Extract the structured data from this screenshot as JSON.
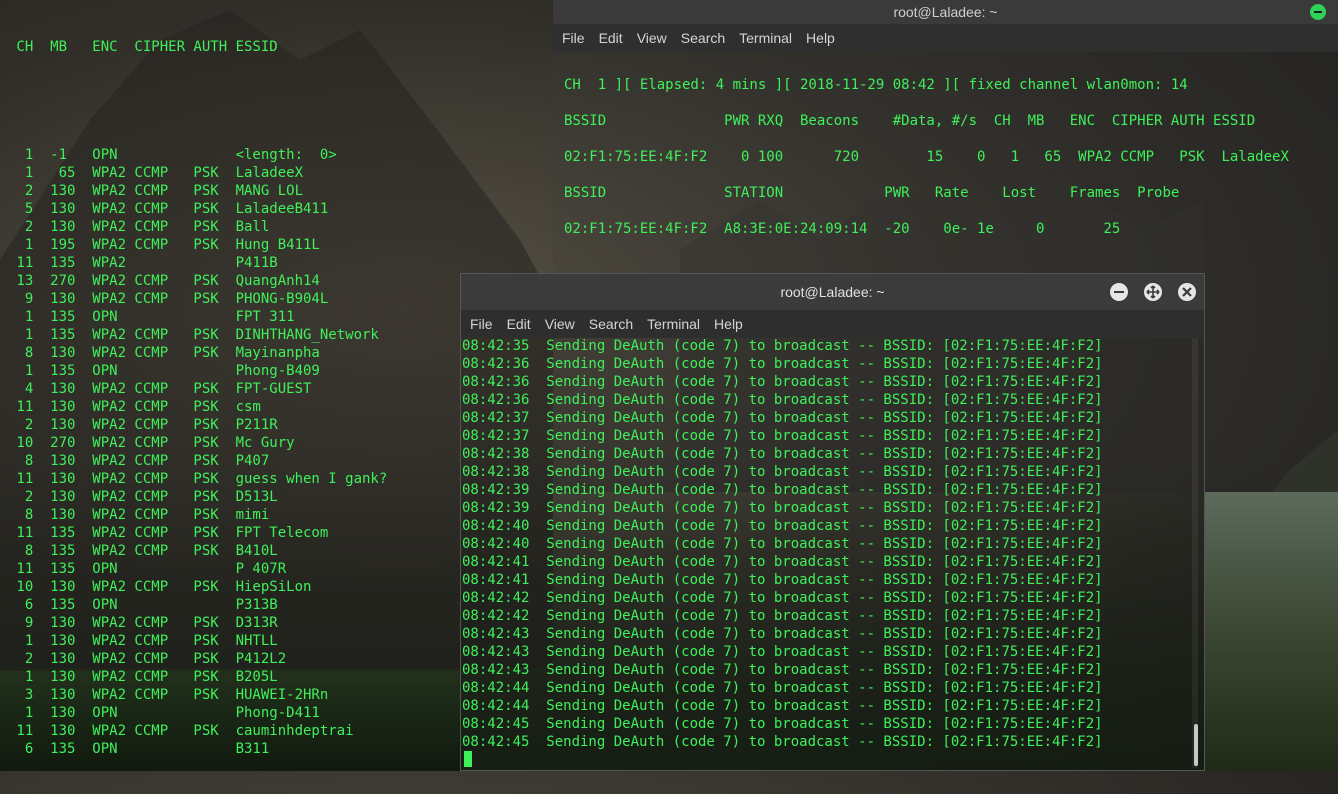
{
  "left_terminal": {
    "header": " CH  MB   ENC  CIPHER AUTH ESSID",
    "rows": [
      "  1  -1   OPN              <length:  0>",
      "  1   65  WPA2 CCMP   PSK  LaladeeX",
      "  2  130  WPA2 CCMP   PSK  MANG LOL",
      "  5  130  WPA2 CCMP   PSK  LaladeeB411",
      "  2  130  WPA2 CCMP   PSK  Ball",
      "  1  195  WPA2 CCMP   PSK  Hung B411L",
      " 11  135  WPA2             P411B",
      " 13  270  WPA2 CCMP   PSK  QuangAnh14",
      "  9  130  WPA2 CCMP   PSK  PHONG-B904L",
      "  1  135  OPN              FPT 311",
      "  1  135  WPA2 CCMP   PSK  DINHTHANG_Network",
      "  8  130  WPA2 CCMP   PSK  Mayinanpha",
      "  1  135  OPN              Phong-B409",
      "  4  130  WPA2 CCMP   PSK  FPT-GUEST",
      " 11  130  WPA2 CCMP   PSK  csm",
      "  2  130  WPA2 CCMP   PSK  P211R",
      " 10  270  WPA2 CCMP   PSK  Mc Gury",
      "  8  130  WPA2 CCMP   PSK  P407",
      " 11  130  WPA2 CCMP   PSK  guess when I gank?",
      "  2  130  WPA2 CCMP   PSK  D513L",
      "  8  130  WPA2 CCMP   PSK  mimi",
      " 11  135  WPA2 CCMP   PSK  FPT Telecom",
      "  8  135  WPA2 CCMP   PSK  B410L",
      " 11  135  OPN              P 407R",
      " 10  130  WPA2 CCMP   PSK  HiepSiLon",
      "  6  135  OPN              P313B",
      "  9  130  WPA2 CCMP   PSK  D313R",
      "  1  130  WPA2 CCMP   PSK  NHTLL",
      "  2  130  WPA2 CCMP   PSK  P412L2",
      "  1  130  WPA2 CCMP   PSK  B205L",
      "  3  130  WPA2 CCMP   PSK  HUAWEI-2HRn",
      "  1  130  OPN              Phong-D411",
      " 11  130  WPA2 CCMP   PSK  cauminhdeptrai",
      "  6  135  OPN              B311"
    ]
  },
  "top_terminal": {
    "title": "root@Laladee: ~",
    "menu": [
      "File",
      "Edit",
      "View",
      "Search",
      "Terminal",
      "Help"
    ],
    "lines": [
      "CH  1 ][ Elapsed: 4 mins ][ 2018-11-29 08:42 ][ fixed channel wlan0mon: 14",
      "",
      "BSSID              PWR RXQ  Beacons    #Data, #/s  CH  MB   ENC  CIPHER AUTH ESSID",
      "",
      "02:F1:75:EE:4F:F2    0 100      720        15    0   1   65  WPA2 CCMP   PSK  LaladeeX",
      "",
      "BSSID              STATION            PWR   Rate    Lost    Frames  Probe",
      "",
      "02:F1:75:EE:4F:F2  A8:3E:0E:24:09:14  -20    0e- 1e     0       25"
    ]
  },
  "front_terminal": {
    "title": "root@Laladee: ~",
    "menu": [
      "File",
      "Edit",
      "View",
      "Search",
      "Terminal",
      "Help"
    ],
    "lines": [
      "08:42:35  Sending DeAuth (code 7) to broadcast -- BSSID: [02:F1:75:EE:4F:F2]",
      "08:42:36  Sending DeAuth (code 7) to broadcast -- BSSID: [02:F1:75:EE:4F:F2]",
      "08:42:36  Sending DeAuth (code 7) to broadcast -- BSSID: [02:F1:75:EE:4F:F2]",
      "08:42:36  Sending DeAuth (code 7) to broadcast -- BSSID: [02:F1:75:EE:4F:F2]",
      "08:42:37  Sending DeAuth (code 7) to broadcast -- BSSID: [02:F1:75:EE:4F:F2]",
      "08:42:37  Sending DeAuth (code 7) to broadcast -- BSSID: [02:F1:75:EE:4F:F2]",
      "08:42:38  Sending DeAuth (code 7) to broadcast -- BSSID: [02:F1:75:EE:4F:F2]",
      "08:42:38  Sending DeAuth (code 7) to broadcast -- BSSID: [02:F1:75:EE:4F:F2]",
      "08:42:39  Sending DeAuth (code 7) to broadcast -- BSSID: [02:F1:75:EE:4F:F2]",
      "08:42:39  Sending DeAuth (code 7) to broadcast -- BSSID: [02:F1:75:EE:4F:F2]",
      "08:42:40  Sending DeAuth (code 7) to broadcast -- BSSID: [02:F1:75:EE:4F:F2]",
      "08:42:40  Sending DeAuth (code 7) to broadcast -- BSSID: [02:F1:75:EE:4F:F2]",
      "08:42:41  Sending DeAuth (code 7) to broadcast -- BSSID: [02:F1:75:EE:4F:F2]",
      "08:42:41  Sending DeAuth (code 7) to broadcast -- BSSID: [02:F1:75:EE:4F:F2]",
      "08:42:42  Sending DeAuth (code 7) to broadcast -- BSSID: [02:F1:75:EE:4F:F2]",
      "08:42:42  Sending DeAuth (code 7) to broadcast -- BSSID: [02:F1:75:EE:4F:F2]",
      "08:42:43  Sending DeAuth (code 7) to broadcast -- BSSID: [02:F1:75:EE:4F:F2]",
      "08:42:43  Sending DeAuth (code 7) to broadcast -- BSSID: [02:F1:75:EE:4F:F2]",
      "08:42:43  Sending DeAuth (code 7) to broadcast -- BSSID: [02:F1:75:EE:4F:F2]",
      "08:42:44  Sending DeAuth (code 7) to broadcast -- BSSID: [02:F1:75:EE:4F:F2]",
      "08:42:44  Sending DeAuth (code 7) to broadcast -- BSSID: [02:F1:75:EE:4F:F2]",
      "08:42:45  Sending DeAuth (code 7) to broadcast -- BSSID: [02:F1:75:EE:4F:F2]",
      "08:42:45  Sending DeAuth (code 7) to broadcast -- BSSID: [02:F1:75:EE:4F:F2]"
    ]
  },
  "icons": {
    "minimize": "minimize-icon",
    "maximize": "maximize-icon",
    "close": "close-icon"
  },
  "colors": {
    "terminal_text": "#3ff05a",
    "title_button": "#2fd15a"
  }
}
